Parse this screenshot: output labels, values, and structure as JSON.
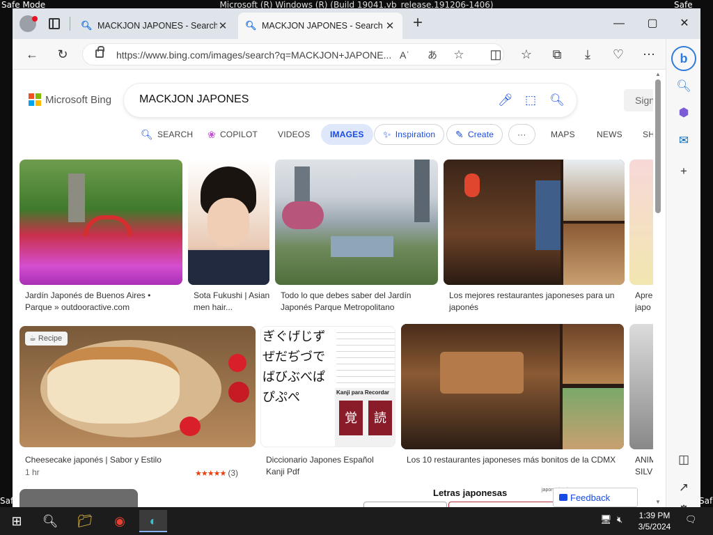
{
  "os": {
    "safe_mode": "Safe Mode",
    "title": "Microsoft (R) Windows (R) (Build 19041.vb_release.191206-1406)"
  },
  "browser": {
    "tabs": [
      {
        "label": "MACKJON JAPONES - Search",
        "active": false
      },
      {
        "label": "MACKJON JAPONES - Search Images",
        "active": true
      }
    ],
    "url": "https://www.bing.com/images/search?q=MACKJON+JAPONE..."
  },
  "bing": {
    "logo": "Microsoft Bing",
    "query": "MACKJON JAPONES",
    "signin": "Sign in",
    "nav": {
      "search": "SEARCH",
      "copilot": "COPILOT",
      "videos": "VIDEOS",
      "images": "IMAGES",
      "inspiration": "Inspiration",
      "create": "Create",
      "more": "···",
      "maps": "MAPS",
      "news": "NEWS",
      "shopping": "SH"
    },
    "results": {
      "r1": {
        "caption": "Jardín Japonés de Buenos Aires • Parque » outdooractive.com"
      },
      "r2": {
        "caption": "Sota Fukushi | Asian men hair..."
      },
      "r3": {
        "caption": "Todo lo que debes saber del Jardín Japonés Parque Metropolitano"
      },
      "r4": {
        "caption": "Los mejores restaurantes japoneses para un japonés"
      },
      "r5": {
        "caption": "Apre japo"
      },
      "r6": {
        "caption": "Cheesecake japonés | Sabor y Estilo",
        "badge": "Recipe",
        "meta": "1 hr",
        "rating_count": "(3)"
      },
      "r7": {
        "caption": "Diccionario Japones Español Kanji Pdf",
        "inner_title": "Kanji para Recordar"
      },
      "r8": {
        "caption": "Los 10 restaurantes japoneses más bonitos de la CDMX"
      },
      "r9": {
        "caption": "ANIM SILV"
      },
      "r10": {
        "title": "Letras japonesas",
        "site": "japonesbasico"
      }
    },
    "feedback": "Feedback"
  },
  "taskbar": {
    "time": "1:39 PM",
    "date": "3/5/2024"
  }
}
